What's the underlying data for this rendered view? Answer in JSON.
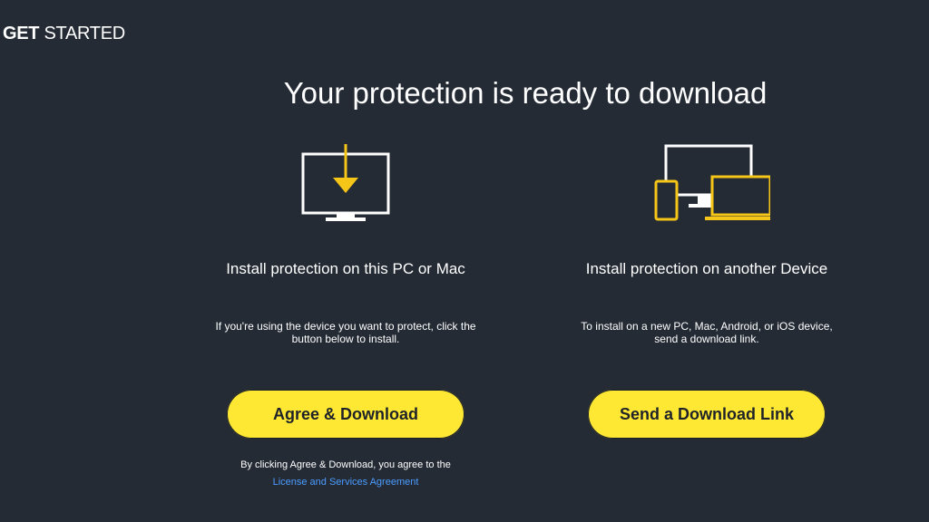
{
  "header": {
    "brand_bold": "GET",
    "brand_light": "STARTED"
  },
  "main": {
    "title": "Your protection is ready to download"
  },
  "options": {
    "this_device": {
      "title": "Install protection on this PC or Mac",
      "description": "If you're using the device you want to protect, click the button below to install.",
      "button_label": "Agree & Download",
      "legal_text": "By clicking Agree & Download, you agree to the",
      "legal_link": "License and Services Agreement",
      "icon": "monitor-download-icon"
    },
    "another_device": {
      "title": "Install protection on another Device",
      "description": "To install on a new PC, Mac, Android, or iOS device, send a download link.",
      "button_label": "Send a Download Link",
      "icon": "multi-device-icon"
    }
  },
  "colors": {
    "background": "#242b35",
    "accent_yellow": "#ffe833",
    "icon_yellow": "#f5c518",
    "link_blue": "#4a9cff",
    "text": "#ffffff"
  }
}
